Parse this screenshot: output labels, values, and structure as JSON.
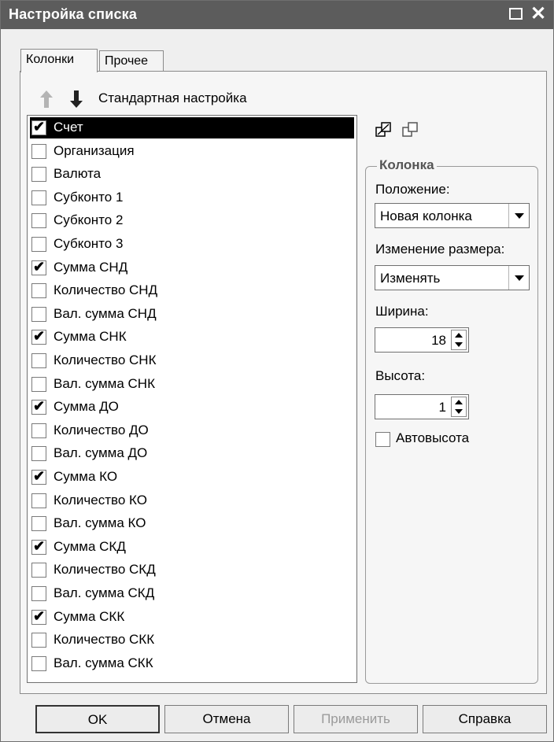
{
  "window": {
    "title": "Настройка списка"
  },
  "tabs": [
    {
      "label": "Колонки"
    },
    {
      "label": "Прочее"
    }
  ],
  "toolbar": {
    "standard_label": "Стандартная настройка"
  },
  "columns": [
    {
      "label": "Счет",
      "checked": true,
      "selected": true
    },
    {
      "label": "Организация",
      "checked": false
    },
    {
      "label": "Валюта",
      "checked": false
    },
    {
      "label": "Субконто 1",
      "checked": false
    },
    {
      "label": "Субконто 2",
      "checked": false
    },
    {
      "label": "Субконто 3",
      "checked": false
    },
    {
      "label": "Сумма СНД",
      "checked": true
    },
    {
      "label": "Количество СНД",
      "checked": false
    },
    {
      "label": "Вал. сумма СНД",
      "checked": false
    },
    {
      "label": "Сумма СНК",
      "checked": true
    },
    {
      "label": "Количество СНК",
      "checked": false
    },
    {
      "label": "Вал. сумма СНК",
      "checked": false
    },
    {
      "label": "Сумма ДО",
      "checked": true
    },
    {
      "label": "Количество ДО",
      "checked": false
    },
    {
      "label": "Вал. сумма ДО",
      "checked": false
    },
    {
      "label": "Сумма КО",
      "checked": true
    },
    {
      "label": "Количество КО",
      "checked": false
    },
    {
      "label": "Вал. сумма КО",
      "checked": false
    },
    {
      "label": "Сумма СКД",
      "checked": true
    },
    {
      "label": "Количество СКД",
      "checked": false
    },
    {
      "label": "Вал. сумма СКД",
      "checked": false
    },
    {
      "label": "Сумма СКК",
      "checked": true
    },
    {
      "label": "Количество СКК",
      "checked": false
    },
    {
      "label": "Вал. сумма СКК",
      "checked": false
    }
  ],
  "column_group": {
    "legend": "Колонка",
    "position_label": "Положение:",
    "position_value": "Новая колонка",
    "resize_label": "Изменение размера:",
    "resize_value": "Изменять",
    "width_label": "Ширина:",
    "width_value": "18",
    "height_label": "Высота:",
    "height_value": "1",
    "auto_height_label": "Автовысота",
    "auto_height_checked": false
  },
  "buttons": {
    "ok": "OK",
    "cancel": "Отмена",
    "apply": "Применить",
    "help": "Справка"
  }
}
